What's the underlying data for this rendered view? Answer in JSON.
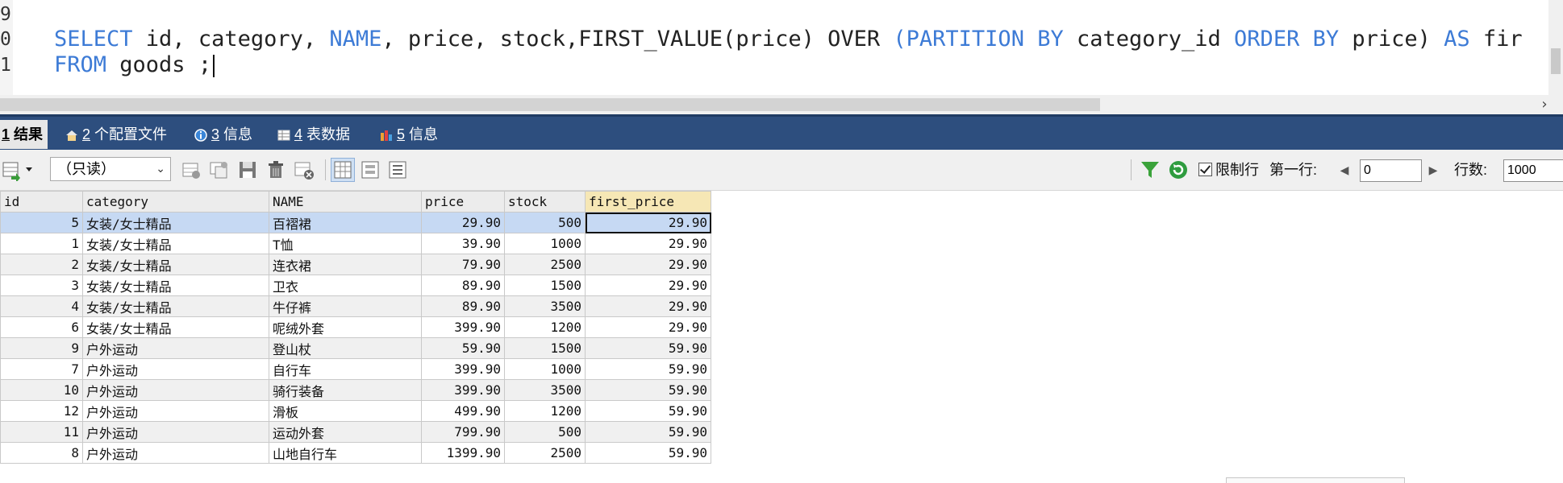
{
  "editor": {
    "line_numbers": [
      "9",
      "0",
      "1"
    ],
    "line1": {
      "kw1": "SELECT",
      "t1": " id, category, ",
      "kw2": "NAME",
      "t2": ", price, stock,FIRST_VALUE(price) OVER ",
      "kw3": "(PARTITION BY",
      "t3": " category_id ",
      "kw4": "ORDER BY",
      "t4": " price) ",
      "kw5": "AS",
      "t5": " fir"
    },
    "line2": {
      "kw1": "FROM",
      "t1": " goods ;"
    },
    "hscroll_arrow": "›"
  },
  "tabs": [
    {
      "num": "1",
      "label": " 结果"
    },
    {
      "num": "2",
      "label": " 个配置文件"
    },
    {
      "num": "3",
      "label": " 信息"
    },
    {
      "num": "4",
      "label": " 表数据"
    },
    {
      "num": "5",
      "label": " 信息"
    }
  ],
  "toolbar": {
    "readonly_combo": "（只读）",
    "combo_arrow": "⌄",
    "limit_rows_label": "限制行",
    "first_row_label": "第一行:",
    "first_row_value": "0",
    "row_count_label": "行数:",
    "row_count_value": "1000",
    "prev_arrow": "◀",
    "next_arrow": "▶"
  },
  "grid": {
    "columns": [
      "id",
      "category",
      "NAME",
      "price",
      "stock",
      "first_price"
    ],
    "rows": [
      [
        "5",
        "女装/女士精品",
        "百褶裙",
        "29.90",
        "500",
        "29.90"
      ],
      [
        "1",
        "女装/女士精品",
        "T恤",
        "39.90",
        "1000",
        "29.90"
      ],
      [
        "2",
        "女装/女士精品",
        "连衣裙",
        "79.90",
        "2500",
        "29.90"
      ],
      [
        "3",
        "女装/女士精品",
        "卫衣",
        "89.90",
        "1500",
        "29.90"
      ],
      [
        "4",
        "女装/女士精品",
        "牛仔裤",
        "89.90",
        "3500",
        "29.90"
      ],
      [
        "6",
        "女装/女士精品",
        "呢绒外套",
        "399.90",
        "1200",
        "29.90"
      ],
      [
        "9",
        "户外运动",
        "登山杖",
        "59.90",
        "1500",
        "59.90"
      ],
      [
        "7",
        "户外运动",
        "自行车",
        "399.90",
        "1000",
        "59.90"
      ],
      [
        "10",
        "户外运动",
        "骑行装备",
        "399.90",
        "3500",
        "59.90"
      ],
      [
        "12",
        "户外运动",
        "滑板",
        "499.90",
        "1200",
        "59.90"
      ],
      [
        "11",
        "户外运动",
        "运动外套",
        "799.90",
        "500",
        "59.90"
      ],
      [
        "8",
        "户外运动",
        "山地自行车",
        "1399.90",
        "2500",
        "59.90"
      ]
    ]
  },
  "colors": {
    "keyword": "#3d7bd6",
    "tab_bar": "#2d4e7e",
    "selected_row": "#c6d9f3",
    "sorted_header": "#f6e7b5"
  }
}
